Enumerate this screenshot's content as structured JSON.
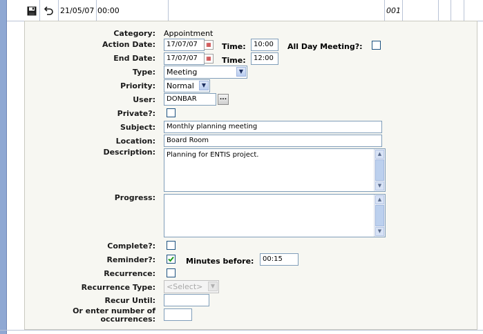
{
  "header_row": {
    "date": "21/05/07",
    "time": "00:00",
    "code": "001"
  },
  "form": {
    "category_label": "Category:",
    "category_value": "Appointment",
    "action_date_label": "Action Date:",
    "action_date_value": "17/07/07",
    "time_label": "Time:",
    "action_time_value": "10:00",
    "all_day_label": "All Day Meeting?:",
    "end_date_label": "End Date:",
    "end_date_value": "17/07/07",
    "end_time_label": "Time:",
    "end_time_value": "12:00",
    "type_label": "Type:",
    "type_value": "Meeting",
    "priority_label": "Priority:",
    "priority_value": "Normal",
    "user_label": "User:",
    "user_value": "DONBAR",
    "user_lookup": "...",
    "private_label": "Private?:",
    "subject_label": "Subject:",
    "subject_value": "Monthly planning meeting",
    "location_label": "Location:",
    "location_value": "Board Room",
    "description_label": "Description:",
    "description_value": "Planning for ENTIS project.",
    "progress_label": "Progress:",
    "progress_value": "",
    "complete_label": "Complete?:",
    "reminder_label": "Reminder?:",
    "reminder_checked": true,
    "minutes_before_label": "Minutes before:",
    "minutes_before_value": "00:15",
    "recurrence_label": "Recurrence:",
    "recurrence_type_label": "Recurrence Type:",
    "recurrence_type_value": "<Select>",
    "recur_until_label": "Recur Until:",
    "occurrences_label_1": "Or enter number of",
    "occurrences_label_2": "occurrences:"
  },
  "colors": {
    "left_strip": "#8fa8d3",
    "panel_bg": "#f7f7f2",
    "checkbox_border": "#1c5180",
    "check_mark": "#1a9a1a"
  }
}
